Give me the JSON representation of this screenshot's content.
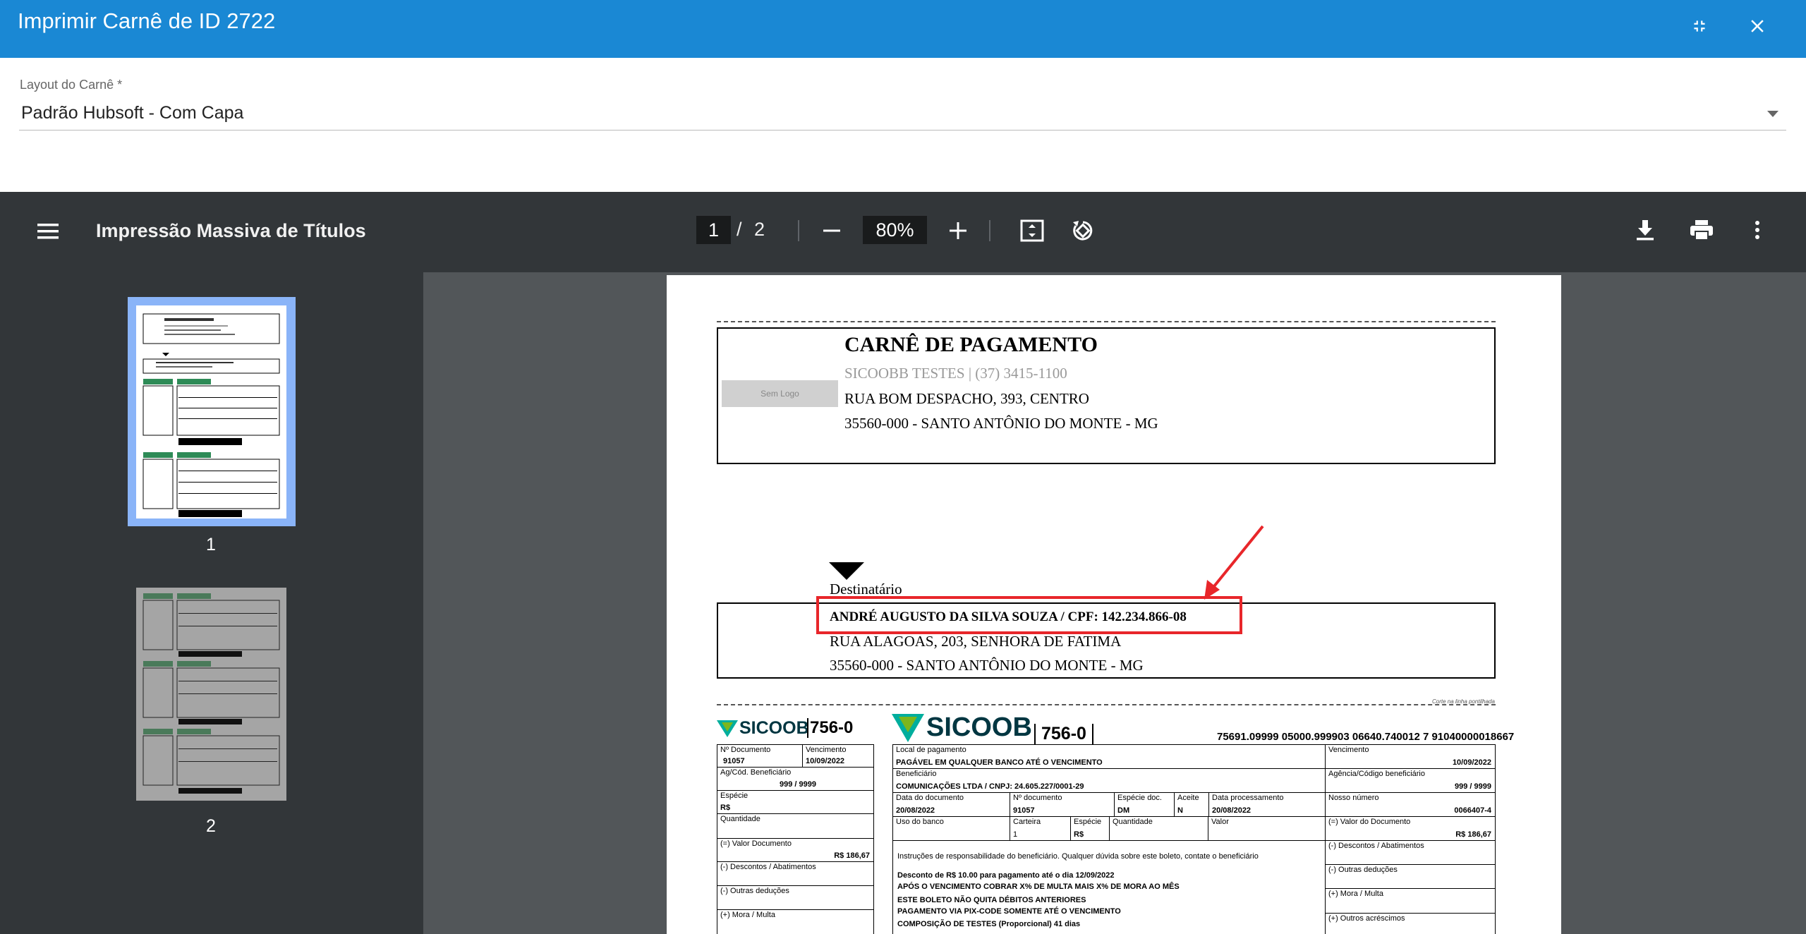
{
  "dialog": {
    "title": "Imprimir Carnê de ID 2722"
  },
  "layout_field": {
    "label": "Layout do Carnê *",
    "value": "Padrão Hubsoft - Com Capa"
  },
  "viewer": {
    "title": "Impressão Massiva de Títulos",
    "page_current": "1",
    "page_separator": "/",
    "page_total": "2",
    "zoom": "80%",
    "thumbnails": [
      {
        "label": "1"
      },
      {
        "label": "2"
      }
    ]
  },
  "cover": {
    "logo_placeholder": "Sem Logo",
    "title": "CARNÊ DE PAGAMENTO",
    "company": "SICOOBB TESTES | (37) 3415-1100",
    "address": "RUA BOM DESPACHO, 393, CENTRO",
    "city": "35560-000 - SANTO ANTÔNIO DO MONTE - MG"
  },
  "recipient": {
    "label": "Destinatário",
    "name": "ANDRÉ AUGUSTO DA SILVA SOUZA / CPF: 142.234.866-08",
    "address": "RUA ALAGOAS, 203, SENHORA DE FATIMA",
    "city": "35560-000 - SANTO ANTÔNIO DO MONTE - MG"
  },
  "boleto": {
    "cut_hint": "Corte na linha pontilhada",
    "bank_brand": "SICOOB",
    "bank_code": "756-0",
    "digitable_line": "75691.09999 05000.999903 06640.740012 7 91040000018667",
    "stub": {
      "num_doc_label": "Nº Documento",
      "num_doc": "91057",
      "venc_label": "Vencimento",
      "venc": "10/09/2022",
      "agencia_label": "Ag/Cód. Beneficiário",
      "agencia": "999 / 9999",
      "especie_label": "Espécie",
      "especie": "R$",
      "quantidade_label": "Quantidade",
      "valor_label": "(=) Valor Documento",
      "valor": "R$ 186,67",
      "descontos_label": "(-) Descontos / Abatimentos",
      "outras_label": "(-) Outras deduções",
      "mora_label": "(+) Mora / Multa"
    },
    "main": {
      "local_label": "Local de pagamento",
      "local": "PAGÁVEL EM QUALQUER BANCO ATÉ O VENCIMENTO",
      "venc_label": "Vencimento",
      "venc": "10/09/2022",
      "benef_label": "Beneficiário",
      "benef": "COMUNICAÇÕES LTDA / CNPJ: 24.605.227/0001-29",
      "agencia_label": "Agência/Código beneficiário",
      "agencia": "999 / 9999",
      "data_doc_label": "Data do documento",
      "data_doc": "20/08/2022",
      "num_doc_label": "Nº documento",
      "num_doc": "91057",
      "especie_doc_label": "Espécie doc.",
      "especie_doc": "DM",
      "aceite_label": "Aceite",
      "aceite": "N",
      "data_proc_label": "Data processamento",
      "data_proc": "20/08/2022",
      "nosso_label": "Nosso número",
      "nosso": "0066407-4",
      "uso_label": "Uso do banco",
      "carteira_label": "Carteira",
      "carteira": "1",
      "especie_label": "Espécie",
      "especie": "R$",
      "quantidade_label": "Quantidade",
      "valor_label": "Valor",
      "valor_doc_label": "(=) Valor do Documento",
      "valor_doc": "R$ 186,67",
      "instrucoes": "Instruções de responsabilidade do beneficiário. Qualquer dúvida sobre este boleto, contate o beneficiário",
      "desconto": "Desconto de R$ 10.00 para pagamento até o dia 12/09/2022",
      "multa": "APÓS O VENCIMENTO COBRAR X% DE MULTA MAIS X% DE MORA AO MÊS",
      "quita": "ESTE BOLETO NÃO QUITA DÉBITOS ANTERIORES",
      "pix": "PAGAMENTO VIA PIX-CODE SOMENTE ATÉ O VENCIMENTO",
      "composicao": "COMPOSIÇÃO DE TESTES (Proporcional) 41 dias",
      "descontos_label": "(-) Descontos / Abatimentos",
      "outras_label": "(-) Outras deduções",
      "mora_label": "(+) Mora / Multa",
      "acrescimos_label": "(+) Outros acréscimos"
    }
  },
  "colors": {
    "header": "#1a88d4",
    "toolbar": "#323639",
    "viewer_bg": "#525659",
    "highlight": "#e8262a",
    "arrow": "#e8262a"
  }
}
